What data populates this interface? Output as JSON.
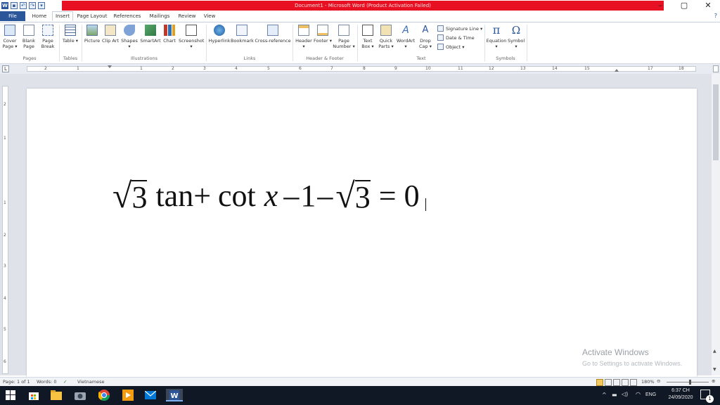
{
  "window": {
    "title": "Document1  -  Microsoft Word (Product Activation Failed)",
    "controls": [
      "–",
      "▢",
      "✕"
    ]
  },
  "quick_access": {
    "app_icon": "W",
    "save_icon": "save-icon",
    "undo_icon": "undo-icon",
    "redo_icon": "redo-icon"
  },
  "tabs": [
    "File",
    "Home",
    "Insert",
    "Page Layout",
    "References",
    "Mailings",
    "Review",
    "View"
  ],
  "ribbon": {
    "pages": {
      "items": [
        "Cover Page ▾",
        "Blank Page",
        "Page Break"
      ],
      "label": "Pages"
    },
    "tables": {
      "items": [
        "Table ▾"
      ],
      "label": "Tables"
    },
    "illustrations": {
      "items": [
        "Picture",
        "Clip Art",
        "Shapes ▾",
        "SmartArt",
        "Chart",
        "Screenshot ▾"
      ],
      "label": "Illustrations"
    },
    "links": {
      "items": [
        "Hyperlink",
        "Bookmark",
        "Cross-reference"
      ],
      "label": "Links"
    },
    "header_footer": {
      "items": [
        "Header ▾",
        "Footer ▾",
        "Page Number ▾"
      ],
      "label": "Header & Footer"
    },
    "text": {
      "items": [
        "Text Box ▾",
        "Quick Parts ▾",
        "WordArt ▾",
        "Drop Cap ▾"
      ],
      "small": [
        "Signature Line ▾",
        "Date & Time",
        "Object ▾"
      ],
      "label": "Text"
    },
    "symbols": {
      "items": [
        "Equation ▾",
        "Symbol ▾"
      ],
      "label": "Symbols"
    }
  },
  "ruler": {
    "tab_selector": "L",
    "numbers": [
      "2",
      "1",
      "1",
      "2",
      "3",
      "4",
      "5",
      "6",
      "7",
      "8",
      "9",
      "10",
      "11",
      "12",
      "13",
      "14",
      "15",
      "17",
      "18"
    ]
  },
  "vruler_numbers": [
    "2",
    "1",
    "1",
    "2",
    "3",
    "4",
    "5",
    "6"
  ],
  "document": {
    "equation": {
      "radicand1": "3",
      "part1": "tan+",
      "part2": "cot",
      "var": "x",
      "part3": "–1–",
      "radicand2": "3",
      "part4": "= 0"
    }
  },
  "watermark": {
    "line1": "Activate Windows",
    "line2": "Go to Settings to activate Windows."
  },
  "status": {
    "page": "Page: 1 of 1",
    "words": "Words: 0",
    "language": "Vietnamese",
    "zoom": "180%"
  },
  "taskbar": {
    "time": "6:37 CH",
    "date": "24/09/2020",
    "lang": "ENG",
    "notif_count": "1"
  },
  "colors": {
    "word_blue": "#2b579a",
    "title_red": "#e81123",
    "taskbar": "#101826"
  }
}
